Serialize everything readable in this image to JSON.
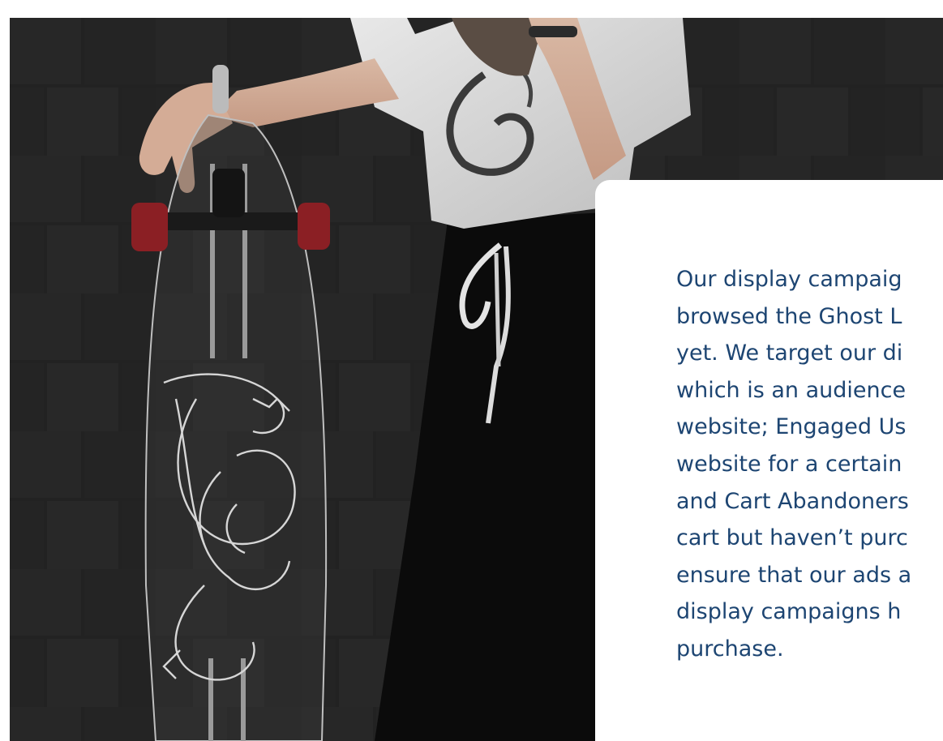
{
  "hero": {
    "image_alt": "Person leaning on a clear longboard with a dragon engraving against a dark brick wall",
    "icon": "photo-image"
  },
  "card": {
    "lines": [
      "Our display campaig",
      "browsed the Ghost L",
      "yet. We target our di",
      "which is an audience",
      "website; Engaged Us",
      "website for a certain",
      "and Cart Abandoners",
      "cart but haven’t purc",
      "ensure that our ads a",
      "display campaigns h",
      "purchase."
    ]
  },
  "colors": {
    "text": "#1d4572",
    "card_background": "#ffffff",
    "wall": "#262626"
  }
}
